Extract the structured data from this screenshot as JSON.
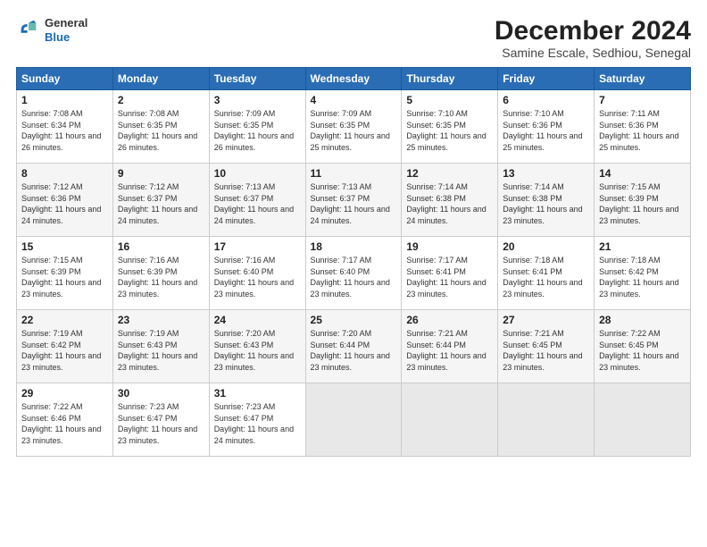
{
  "logo": {
    "general": "General",
    "blue": "Blue"
  },
  "title": "December 2024",
  "location": "Samine Escale, Sedhiou, Senegal",
  "headers": [
    "Sunday",
    "Monday",
    "Tuesday",
    "Wednesday",
    "Thursday",
    "Friday",
    "Saturday"
  ],
  "weeks": [
    [
      {
        "day": "1",
        "sunrise": "7:08 AM",
        "sunset": "6:34 PM",
        "daylight": "11 hours and 26 minutes."
      },
      {
        "day": "2",
        "sunrise": "7:08 AM",
        "sunset": "6:35 PM",
        "daylight": "11 hours and 26 minutes."
      },
      {
        "day": "3",
        "sunrise": "7:09 AM",
        "sunset": "6:35 PM",
        "daylight": "11 hours and 26 minutes."
      },
      {
        "day": "4",
        "sunrise": "7:09 AM",
        "sunset": "6:35 PM",
        "daylight": "11 hours and 25 minutes."
      },
      {
        "day": "5",
        "sunrise": "7:10 AM",
        "sunset": "6:35 PM",
        "daylight": "11 hours and 25 minutes."
      },
      {
        "day": "6",
        "sunrise": "7:10 AM",
        "sunset": "6:36 PM",
        "daylight": "11 hours and 25 minutes."
      },
      {
        "day": "7",
        "sunrise": "7:11 AM",
        "sunset": "6:36 PM",
        "daylight": "11 hours and 25 minutes."
      }
    ],
    [
      {
        "day": "8",
        "sunrise": "7:12 AM",
        "sunset": "6:36 PM",
        "daylight": "11 hours and 24 minutes."
      },
      {
        "day": "9",
        "sunrise": "7:12 AM",
        "sunset": "6:37 PM",
        "daylight": "11 hours and 24 minutes."
      },
      {
        "day": "10",
        "sunrise": "7:13 AM",
        "sunset": "6:37 PM",
        "daylight": "11 hours and 24 minutes."
      },
      {
        "day": "11",
        "sunrise": "7:13 AM",
        "sunset": "6:37 PM",
        "daylight": "11 hours and 24 minutes."
      },
      {
        "day": "12",
        "sunrise": "7:14 AM",
        "sunset": "6:38 PM",
        "daylight": "11 hours and 24 minutes."
      },
      {
        "day": "13",
        "sunrise": "7:14 AM",
        "sunset": "6:38 PM",
        "daylight": "11 hours and 23 minutes."
      },
      {
        "day": "14",
        "sunrise": "7:15 AM",
        "sunset": "6:39 PM",
        "daylight": "11 hours and 23 minutes."
      }
    ],
    [
      {
        "day": "15",
        "sunrise": "7:15 AM",
        "sunset": "6:39 PM",
        "daylight": "11 hours and 23 minutes."
      },
      {
        "day": "16",
        "sunrise": "7:16 AM",
        "sunset": "6:39 PM",
        "daylight": "11 hours and 23 minutes."
      },
      {
        "day": "17",
        "sunrise": "7:16 AM",
        "sunset": "6:40 PM",
        "daylight": "11 hours and 23 minutes."
      },
      {
        "day": "18",
        "sunrise": "7:17 AM",
        "sunset": "6:40 PM",
        "daylight": "11 hours and 23 minutes."
      },
      {
        "day": "19",
        "sunrise": "7:17 AM",
        "sunset": "6:41 PM",
        "daylight": "11 hours and 23 minutes."
      },
      {
        "day": "20",
        "sunrise": "7:18 AM",
        "sunset": "6:41 PM",
        "daylight": "11 hours and 23 minutes."
      },
      {
        "day": "21",
        "sunrise": "7:18 AM",
        "sunset": "6:42 PM",
        "daylight": "11 hours and 23 minutes."
      }
    ],
    [
      {
        "day": "22",
        "sunrise": "7:19 AM",
        "sunset": "6:42 PM",
        "daylight": "11 hours and 23 minutes."
      },
      {
        "day": "23",
        "sunrise": "7:19 AM",
        "sunset": "6:43 PM",
        "daylight": "11 hours and 23 minutes."
      },
      {
        "day": "24",
        "sunrise": "7:20 AM",
        "sunset": "6:43 PM",
        "daylight": "11 hours and 23 minutes."
      },
      {
        "day": "25",
        "sunrise": "7:20 AM",
        "sunset": "6:44 PM",
        "daylight": "11 hours and 23 minutes."
      },
      {
        "day": "26",
        "sunrise": "7:21 AM",
        "sunset": "6:44 PM",
        "daylight": "11 hours and 23 minutes."
      },
      {
        "day": "27",
        "sunrise": "7:21 AM",
        "sunset": "6:45 PM",
        "daylight": "11 hours and 23 minutes."
      },
      {
        "day": "28",
        "sunrise": "7:22 AM",
        "sunset": "6:45 PM",
        "daylight": "11 hours and 23 minutes."
      }
    ],
    [
      {
        "day": "29",
        "sunrise": "7:22 AM",
        "sunset": "6:46 PM",
        "daylight": "11 hours and 23 minutes."
      },
      {
        "day": "30",
        "sunrise": "7:23 AM",
        "sunset": "6:47 PM",
        "daylight": "11 hours and 23 minutes."
      },
      {
        "day": "31",
        "sunrise": "7:23 AM",
        "sunset": "6:47 PM",
        "daylight": "11 hours and 24 minutes."
      },
      null,
      null,
      null,
      null
    ]
  ]
}
